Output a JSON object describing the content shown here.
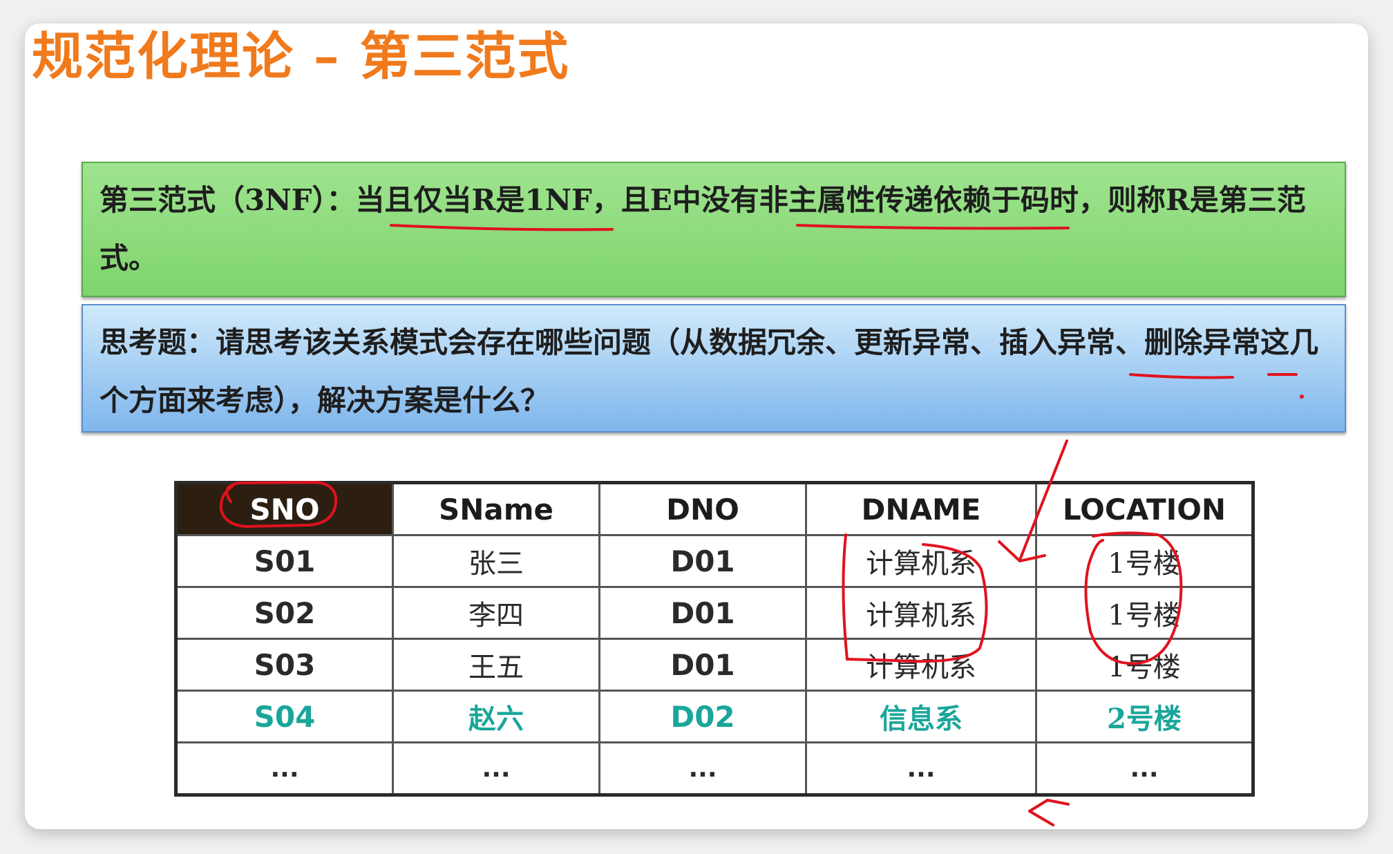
{
  "title": "规范化理论 – 第三范式",
  "definition": {
    "prefix": "第三范式（3NF）：",
    "underline_a": "当且仅当R是1NF",
    "middle": "，且E中没有",
    "underline_b": "非主属性传递依赖",
    "suffix": "于码时，则称R是第三范式。"
  },
  "question": {
    "prefix": "思考题：请思考该关系模式会存在哪些问题（从数据冗余、更新异常、",
    "underline_a": "插入异常",
    "sep": "、",
    "underline_b": "删",
    "suffix": "除异常这几个方面来考虑），解决方案是什么？"
  },
  "table": {
    "headers": [
      "SNO",
      "SName",
      "DNO",
      "DNAME",
      "LOCATION"
    ],
    "rows": [
      [
        "S01",
        "张三",
        "D01",
        "计算机系",
        "1号楼"
      ],
      [
        "S02",
        "李四",
        "D01",
        "计算机系",
        "1号楼"
      ],
      [
        "S03",
        "王五",
        "D01",
        "计算机系",
        "1号楼"
      ],
      [
        "S04",
        "赵六",
        "D02",
        "信息系",
        "2号楼"
      ],
      [
        "...",
        "...",
        "...",
        "...",
        "..."
      ]
    ]
  },
  "colors": {
    "title": "#f07a1c",
    "highlight_row": "#1aa69a",
    "annotation_ink": "#e0121e"
  }
}
